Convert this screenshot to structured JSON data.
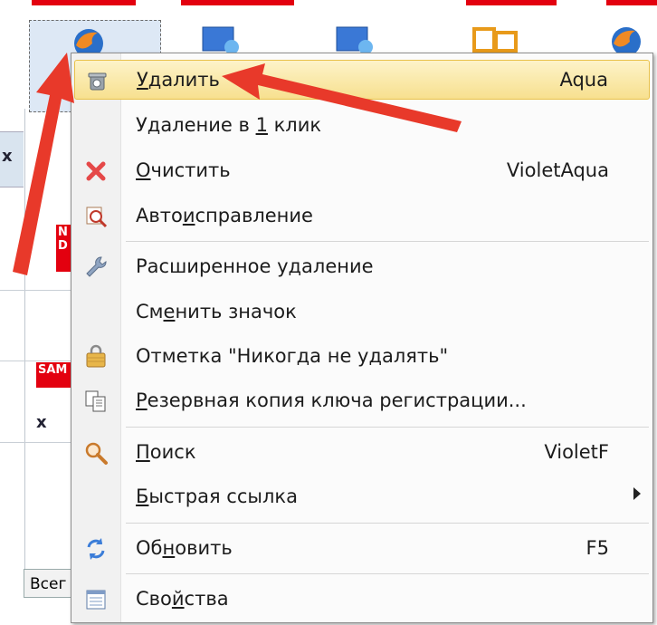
{
  "background": {
    "left_marks": [
      "x",
      "x"
    ],
    "badges": [
      "N\nD",
      "SAM"
    ],
    "bottom_tab": "Всег"
  },
  "menu": {
    "items": [
      {
        "pre": "",
        "ul": "У",
        "post": "далить",
        "shortcut": "Aqua",
        "icon": "recycle-bin-icon",
        "highlighted": true
      },
      {
        "pre": "Удаление в ",
        "ul": "1",
        "post": " клик",
        "shortcut": "",
        "icon": "",
        "highlighted": false
      },
      {
        "pre": "",
        "ul": "О",
        "post": "чистить",
        "shortcut": "VioletAqua",
        "icon": "red-x-icon",
        "highlighted": false
      },
      {
        "pre": "Авто",
        "ul": "и",
        "post": "справление",
        "shortcut": "",
        "icon": "magnifier-fix-icon",
        "highlighted": false
      },
      {
        "pre": "Расширенное удаление",
        "ul": "",
        "post": "",
        "shortcut": "",
        "icon": "wrench-icon",
        "highlighted": false
      },
      {
        "pre": "См",
        "ul": "е",
        "post": "нить значок",
        "shortcut": "",
        "icon": "",
        "highlighted": false
      },
      {
        "pre": "Отметка \"Никогда не удалять\"",
        "ul": "",
        "post": "",
        "shortcut": "",
        "icon": "lock-icon",
        "highlighted": false
      },
      {
        "pre": "",
        "ul": "Р",
        "post": "езервная копия ключа регистрации...",
        "shortcut": "",
        "icon": "copy-icon",
        "highlighted": false
      },
      {
        "pre": "",
        "ul": "П",
        "post": "оиск",
        "shortcut": "VioletF",
        "icon": "search-icon",
        "highlighted": false
      },
      {
        "pre": "",
        "ul": "Б",
        "post": "ыстрая ссылка",
        "shortcut": "",
        "icon": "",
        "highlighted": false,
        "submenu": true
      },
      {
        "pre": "Об",
        "ul": "н",
        "post": "овить",
        "shortcut": "F5",
        "icon": "refresh-icon",
        "highlighted": false
      },
      {
        "pre": "Сво",
        "ul": "й",
        "post": "ства",
        "shortcut": "",
        "icon": "properties-icon",
        "highlighted": false
      }
    ]
  },
  "colors": {
    "highlight": "#f7e08f",
    "annotation_arrow": "#e8392a",
    "brand_red": "#e3000f"
  }
}
